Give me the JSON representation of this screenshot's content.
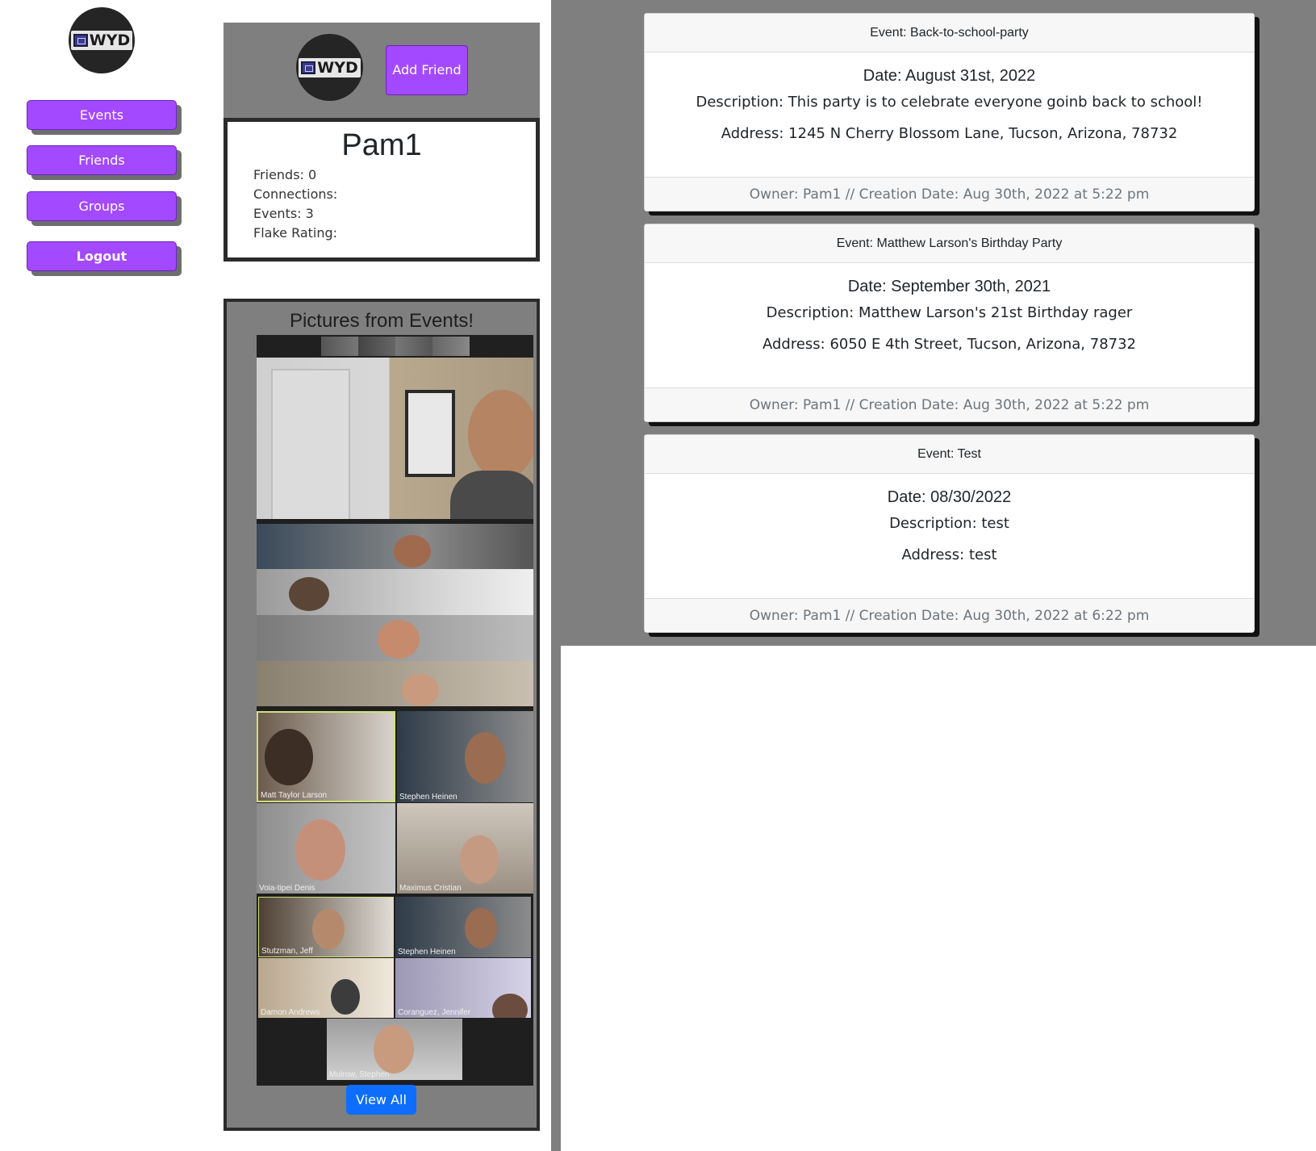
{
  "brand": {
    "logo_text": "WYD"
  },
  "nav": {
    "events": "Events",
    "friends": "Friends",
    "groups": "Groups",
    "logout": "Logout"
  },
  "profile": {
    "logo_text": "WYD",
    "add_friend_label": "Add Friend",
    "username": "Pam1",
    "friends": "Friends: 0",
    "connections": "Connections:",
    "events": "Events: 3",
    "flake_rating": "Flake Rating:"
  },
  "pictures": {
    "title": "Pictures from Events!",
    "view_all_label": "View All",
    "participants": [
      "Matt Taylor Larson",
      "Stephen Heinen",
      "Voia-tipei Denis",
      "Maximus Cristian",
      "Stutzman, Jeff",
      "Stephen Heinen",
      "Damon Andrews",
      "Coranguez, Jennifer",
      "Mulrow, Stephen"
    ]
  },
  "events": [
    {
      "header": "Event: Back-to-school-party",
      "date": "Date: August 31st, 2022",
      "description": "Description: This party is to celebrate everyone goinb back to school!",
      "address": "Address: 1245 N Cherry Blossom Lane, Tucson, Arizona, 78732",
      "footer": "Owner: Pam1 // Creation Date: Aug 30th, 2022 at 5:22 pm"
    },
    {
      "header": "Event: Matthew Larson's Birthday Party",
      "date": "Date: September 30th, 2021",
      "description": "Description: Matthew Larson's 21st Birthday rager",
      "address": "Address: 6050 E 4th Street, Tucson, Arizona, 78732",
      "footer": "Owner: Pam1 // Creation Date: Aug 30th, 2022 at 5:22 pm"
    },
    {
      "header": "Event: Test",
      "date": "Date: 08/30/2022",
      "description": "Description: test",
      "address": "Address: test",
      "footer": "Owner: Pam1 // Creation Date: Aug 30th, 2022 at 6:22 pm"
    }
  ],
  "colors": {
    "accent": "#a349ff",
    "panel_gray": "#7f7f7f",
    "primary_button": "#0d6efd"
  }
}
